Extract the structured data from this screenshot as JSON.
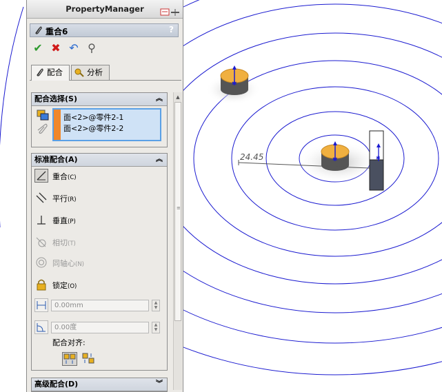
{
  "panel_title": "PropertyManager",
  "feature_title": "重合6",
  "help_icon": "?",
  "tabs": [
    {
      "label": "配合",
      "icon": "paperclip-icon"
    },
    {
      "label": "分析",
      "icon": "key-icon"
    }
  ],
  "mate_selections": {
    "header": "配合选择(S)",
    "items": [
      "面<2>@零件2-1",
      "面<2>@零件2-2"
    ]
  },
  "standard_mates": {
    "header": "标准配合(A)",
    "items": [
      {
        "label": "重合",
        "key": "(C)"
      },
      {
        "label": "平行",
        "key": "(R)"
      },
      {
        "label": "垂直",
        "key": "(P)"
      },
      {
        "label": "相切",
        "key": "(T)"
      },
      {
        "label": "同轴心",
        "key": "(N)"
      },
      {
        "label": "锁定",
        "key": "(O)"
      }
    ],
    "distance_value": "0.00mm",
    "angle_value": "0.00度",
    "alignment_label": "配合对齐:"
  },
  "advanced_mates": {
    "header": "高级配合(D)"
  },
  "dimension_text": "24.45",
  "colors": {
    "accent_orange": "#f0872a",
    "selection_bg": "#cfe2f6",
    "circle_blue": "#1a1ad0"
  }
}
